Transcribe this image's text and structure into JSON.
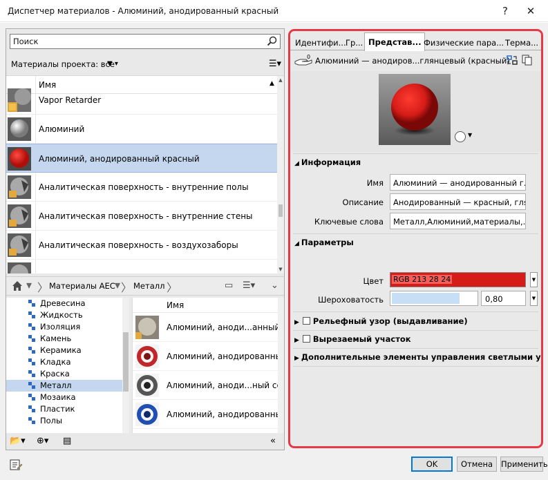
{
  "window": {
    "title": "Диспетчер материалов - Алюминий, анодированный красный",
    "help_glyph": "?",
    "close_glyph": "✕"
  },
  "browser": {
    "search_placeholder": "Поиск",
    "filter_label": "Материалы проекта: все",
    "name_header": "Имя",
    "materials": [
      {
        "name": "Vapor Retarder",
        "thumb": "grey-partial"
      },
      {
        "name": "Алюминий",
        "thumb": "grey-sphere"
      },
      {
        "name": "Алюминий, анодированный красный",
        "thumb": "red-sphere",
        "selected": true
      },
      {
        "name": "Аналитическая поверхность - внутренние полы",
        "thumb": "grey-sphere"
      },
      {
        "name": "Аналитическая поверхность - внутренние стены",
        "thumb": "grey-sphere"
      },
      {
        "name": "Аналитическая поверхность - воздухозаборы",
        "thumb": "grey-sphere"
      }
    ],
    "breadcrumb": [
      "Материалы AEC",
      "Металл"
    ],
    "categories": [
      "Древесина",
      "Жидкость",
      "Изоляция",
      "Камень",
      "Керамика",
      "Кладка",
      "Краска",
      "Металл",
      "Мозаика",
      "Пластик",
      "Полы"
    ],
    "selected_category": "Металл",
    "assets_header": "Имя",
    "assets": [
      {
        "name": "Алюминий, аноди...анный бр",
        "color": "#c9c3b6"
      },
      {
        "name": "Алюминий, анодированный",
        "color": "#c0262a"
      },
      {
        "name": "Алюминий, аноди...ный сере",
        "color": "#555555"
      },
      {
        "name": "Алюминий, анодированный",
        "color": "#1f4fb0"
      }
    ]
  },
  "editor": {
    "tabs": [
      "Идентифи...",
      "Гр...",
      "Представ...",
      "Физические пара...",
      "Терма..."
    ],
    "active_tab": 2,
    "asset_badge": "0",
    "asset_name": "Алюминий — анодиров...глянцевый (красный)",
    "info_section": "Информация",
    "fields": [
      {
        "label": "Имя",
        "value": "Алюминий — анодированный г..."
      },
      {
        "label": "Описание",
        "value": "Анодированный — красный, гля..."
      },
      {
        "label": "Ключевые слова",
        "value": "Металл,Алюминий,материалы,..."
      }
    ],
    "params_section": "Параметры",
    "color_label": "Цвет",
    "color_value": "RGB 213 28 24",
    "color_hex": "#d51c18",
    "roughness_label": "Шероховатость",
    "roughness_value": "0,80",
    "collapsed_sections": [
      {
        "label": "Рельефный узор (выдавливание)",
        "checkbox": true
      },
      {
        "label": "Вырезаемый участок",
        "checkbox": true
      },
      {
        "label": "Дополнительные элементы управления светлыми участками",
        "checkbox": false
      }
    ]
  },
  "footer": {
    "ok": "OK",
    "cancel": "Отмена",
    "apply": "Применить"
  }
}
